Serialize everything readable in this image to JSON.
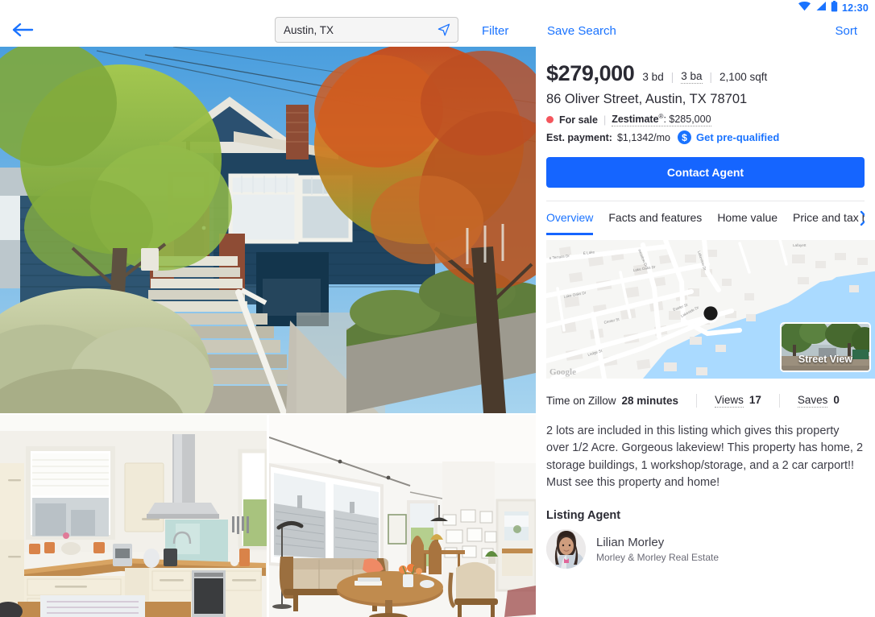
{
  "status_bar": {
    "time": "12:30",
    "icons": [
      "wifi-icon",
      "signal-icon",
      "battery-icon"
    ],
    "color": "#1a73ff"
  },
  "top_bar": {
    "back_icon": "back-arrow-icon",
    "search": {
      "value": "Austin, TX",
      "placeholder": "Austin, TX",
      "locate_icon": "navigation-arrow-icon"
    },
    "filter_label": "Filter",
    "save_search_label": "Save Search",
    "sort_label": "Sort",
    "link_color": "#1a73ff"
  },
  "gallery": {
    "main_photo_alt": "blue craftsman house front exterior with stairs and autumn tree",
    "photo_2_alt": "cream kitchen with wood countertops and stainless range hood",
    "photo_3_alt": "bright living room with mid-century sofa and large windows"
  },
  "listing": {
    "price": "$279,000",
    "beds": "3 bd",
    "baths": "3 ba",
    "sqft": "2,100 sqft",
    "address": "86 Oliver Street, Austin, TX 78701",
    "status": "For sale",
    "status_color": "#f4565d",
    "zestimate_label": "Zestimate",
    "zestimate_sup": "®",
    "zestimate_value": "$285,000",
    "payment_label": "Est. payment:",
    "payment_value": "$1,1342/mo",
    "prequalified_label": "Get pre-qualified",
    "dollar_icon": "dollar-circle-icon",
    "contact_button": "Contact Agent",
    "accent_color": "#1565ff"
  },
  "tabs": {
    "items": [
      {
        "label": "Overview",
        "active": true
      },
      {
        "label": "Facts and features",
        "active": false
      },
      {
        "label": "Home value",
        "active": false
      },
      {
        "label": "Price and tax hist",
        "active": false
      }
    ],
    "next_icon": "chevron-right-icon"
  },
  "map": {
    "streets": [
      "e Terrace Dr",
      "E Lake",
      "Lake Oaks Dr",
      "Lake Oaks Dr",
      "Center St",
      "Ledge St",
      "Lakeside Dr",
      "Easter St",
      "Lafayett",
      "meadow Dr",
      "Lakeview Dr"
    ],
    "marker_icon": "location-marker-icon",
    "street_view_label": "Street View",
    "watermark": "Google",
    "water_color": "#aadaff",
    "land_color": "#f6f6f4"
  },
  "stats": [
    {
      "label": "Time on Zillow",
      "value": "28 minutes",
      "dotted": false
    },
    {
      "label": "Views",
      "value": "17",
      "dotted": true
    },
    {
      "label": "Saves",
      "value": "0",
      "dotted": true
    }
  ],
  "description": "2 lots are included in this listing which gives this property over 1/2 Acre. Gorgeous lakeview! This property has home, 2 storage buildings, 1 workshop/storage, and a 2 car carport!! Must see this property and home!",
  "agent": {
    "heading": "Listing Agent",
    "name": "Lilian Morley",
    "organization": "Morley & Morley Real Estate",
    "photo_alt": "portrait of listing agent"
  }
}
